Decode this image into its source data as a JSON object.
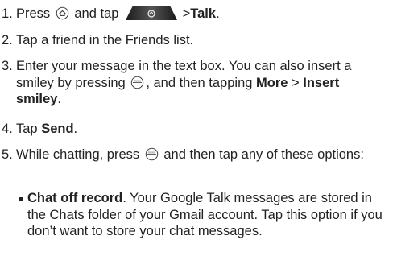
{
  "steps": [
    {
      "num": "1.",
      "a": "Press",
      "b": "and tap",
      "c": ">",
      "d": "Talk",
      "e": "."
    },
    {
      "num": "2.",
      "text": "Tap a friend in the Friends list."
    },
    {
      "num": "3.",
      "a": "Enter your message in the text box. You can also insert a smiley by pressing",
      "b": ", and then tapping",
      "c": "More",
      "d": " > ",
      "e": "Insert smiley",
      "f": "."
    },
    {
      "num": "4.",
      "a": "Tap",
      "b": "Send",
      "c": "."
    },
    {
      "num": "5.",
      "a": "While chatting, press",
      "b": "and then tap any of these options:"
    }
  ],
  "bullet": {
    "title": "Chat off record",
    "text": ". Your Google Talk messages are stored in the Chats folder of your Gmail account. Tap this option if you don’t want to store your chat messages."
  },
  "icons": {
    "home": "home-button-icon",
    "tab": "launcher-tab-icon",
    "menu": "menu-button-icon"
  }
}
